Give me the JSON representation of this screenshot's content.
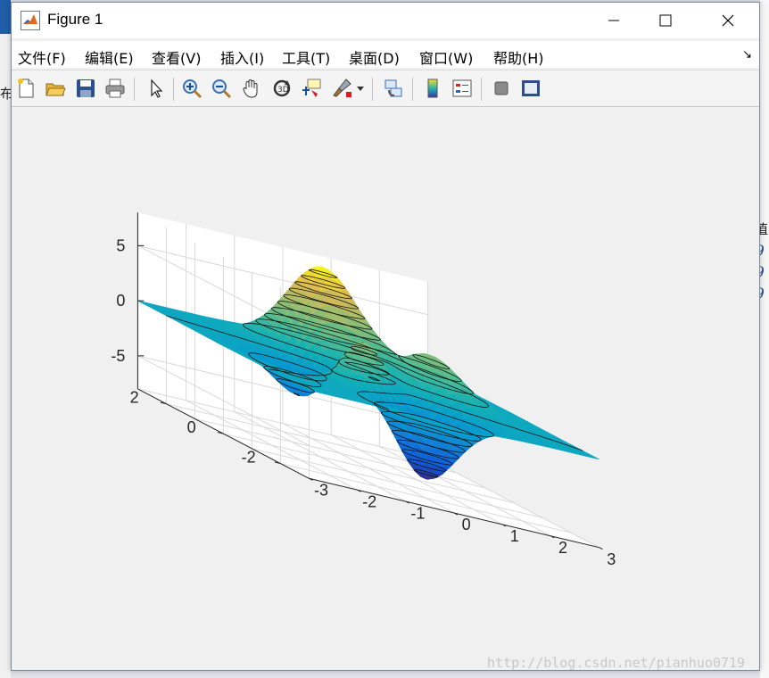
{
  "window": {
    "title": "Figure 1"
  },
  "window_controls": {
    "minimize": "—",
    "maximize": "☐",
    "close": "✕"
  },
  "menu": [
    {
      "label": "文件(F)"
    },
    {
      "label": "编辑(E)"
    },
    {
      "label": "查看(V)"
    },
    {
      "label": "插入(I)"
    },
    {
      "label": "工具(T)"
    },
    {
      "label": "桌面(D)"
    },
    {
      "label": "窗口(W)"
    },
    {
      "label": "帮助(H)"
    }
  ],
  "toolbar": [
    {
      "icon": "new-figure-icon"
    },
    {
      "icon": "open-file-icon"
    },
    {
      "icon": "save-icon"
    },
    {
      "icon": "print-icon"
    },
    {
      "icon": "edit-plot-arrow-icon"
    },
    {
      "icon": "zoom-in-icon"
    },
    {
      "icon": "zoom-out-icon"
    },
    {
      "icon": "pan-hand-icon"
    },
    {
      "icon": "rotate-3d-icon"
    },
    {
      "icon": "data-cursor-icon"
    },
    {
      "icon": "brush-icon"
    },
    {
      "icon": "link-plot-icon"
    },
    {
      "icon": "insert-colorbar-icon"
    },
    {
      "icon": "insert-legend-icon"
    },
    {
      "icon": "hide-plot-tools-icon"
    },
    {
      "icon": "show-plot-tools-icon"
    }
  ],
  "background_fragments": {
    "left_char": "布",
    "right_header": "值",
    "right_values": [
      "9",
      "9",
      "9"
    ]
  },
  "chart_data": {
    "type": "surface",
    "surface_function": "peaks",
    "style": "surfc (filled surface with contour lines)",
    "colormap": "parula",
    "x_range": [
      -3,
      3
    ],
    "y_range": [
      -3,
      3
    ],
    "z_range": [
      -8,
      8
    ],
    "x_ticks": [
      "-3",
      "-2",
      "-1",
      "0",
      "1",
      "2",
      "3"
    ],
    "y_ticks": [
      "-2",
      "0",
      "2"
    ],
    "z_ticks": [
      "-5",
      "0",
      "5"
    ],
    "z_max": 8.1,
    "z_min": -6.5,
    "peaks": [
      {
        "x": -0.01,
        "y": 1.58,
        "z": 8.1
      },
      {
        "x": -0.46,
        "y": -0.63,
        "z": 3.78
      },
      {
        "x": 1.29,
        "y": 0.0,
        "z": 3.59
      }
    ],
    "valleys": [
      {
        "x": 0.23,
        "y": -1.63,
        "z": -6.55
      },
      {
        "x": -1.35,
        "y": 0.2,
        "z": -3.05
      }
    ],
    "grid": true,
    "title": "",
    "xlabel": "",
    "ylabel": "",
    "zlabel": ""
  },
  "watermark": "http://blog.csdn.net/pianhuo0719"
}
